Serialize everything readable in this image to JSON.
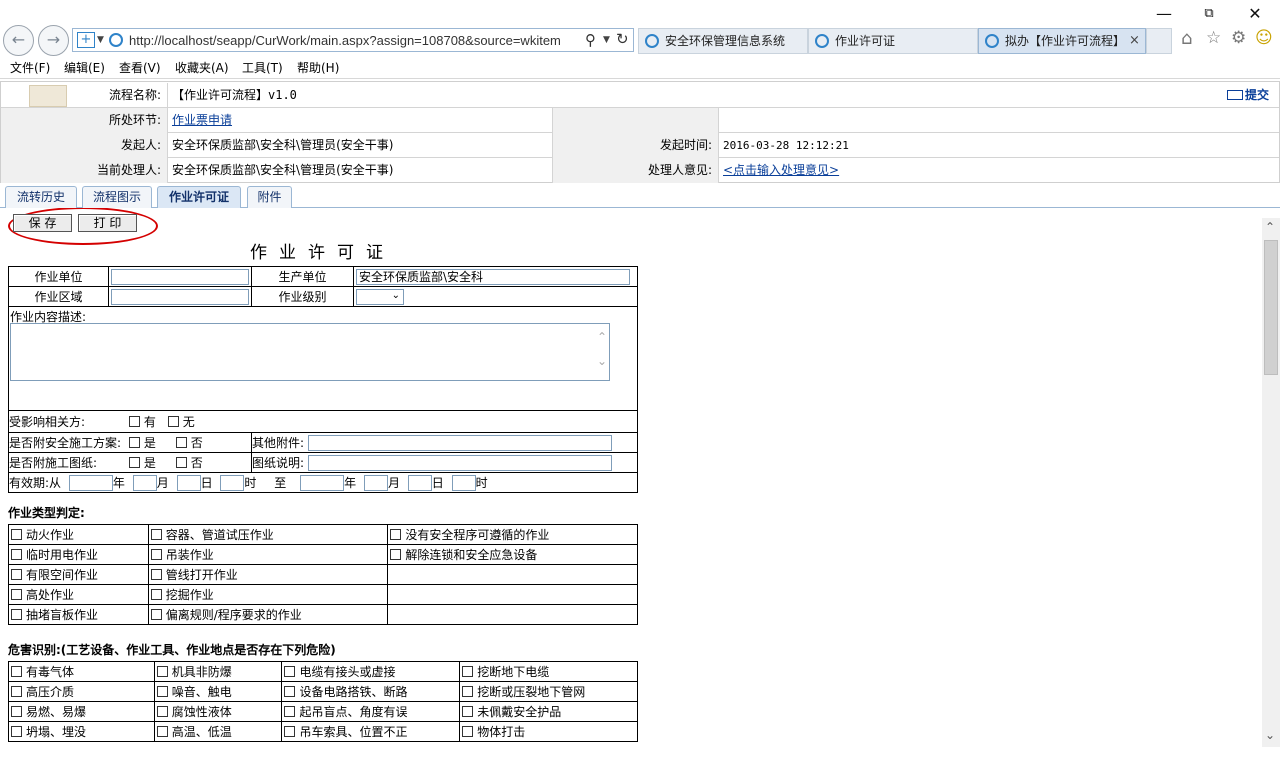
{
  "browser": {
    "url": "http://localhost/seapp/CurWork/main.aspx?assign=108708&source=wkitem",
    "tabs": [
      {
        "label": "安全环保管理信息系统",
        "active": false
      },
      {
        "label": "作业许可证",
        "active": false
      },
      {
        "label": "拟办【作业许可流程】",
        "active": true
      }
    ],
    "menu": [
      "文件(F)",
      "编辑(E)",
      "查看(V)",
      "收藏夹(A)",
      "工具(T)",
      "帮助(H)"
    ]
  },
  "header": {
    "flow_name_label": "流程名称:",
    "flow_name": "【作业许可流程】v1.0",
    "submit_label": "提交",
    "step_label": "所处环节:",
    "step_value": "作业票申请",
    "initiator_label": "发起人:",
    "initiator": "安全环保质监部\\安全科\\管理员(安全干事)",
    "start_time_label": "发起时间:",
    "start_time": "2016-03-28 12:12:21",
    "handler_label": "当前处理人:",
    "handler": "安全环保质监部\\安全科\\管理员(安全干事)",
    "opinion_label": "处理人意见:",
    "opinion_link": "<点击输入处理意见>"
  },
  "form_tabs": [
    {
      "label": "流转历史",
      "active": false
    },
    {
      "label": "流程图示",
      "active": false
    },
    {
      "label": "作业许可证",
      "active": true
    },
    {
      "label": "附件",
      "active": false
    }
  ],
  "actions": {
    "save": "保 存",
    "print": "打 印"
  },
  "form": {
    "title": "作业许可证",
    "work_unit_label": "作业单位",
    "work_unit_value": "",
    "prod_unit_label": "生产单位",
    "prod_unit_value": "安全环保质监部\\安全科",
    "work_area_label": "作业区域",
    "work_area_value": "",
    "work_level_label": "作业级别",
    "work_level_value": "",
    "desc_label": "作业内容描述:",
    "affected_label": "受影响相关方:",
    "opt_yes": "有",
    "opt_no": "无",
    "plan_label": "是否附安全施工方案:",
    "drawing_label": "是否附施工图纸:",
    "yes": "是",
    "no": "否",
    "other_attach_label": "其他附件:",
    "drawing_desc_label": "图纸说明:",
    "validity_label": "有效期:从",
    "year": "年",
    "month": "月",
    "day": "日",
    "hour": "时",
    "to": "至"
  },
  "work_types": {
    "title": "作业类型判定:",
    "rows": [
      [
        "动火作业",
        "容器、管道试压作业",
        "没有安全程序可遵循的作业"
      ],
      [
        "临时用电作业",
        "吊装作业",
        "解除连锁和安全应急设备"
      ],
      [
        "有限空间作业",
        "管线打开作业",
        ""
      ],
      [
        "高处作业",
        "挖掘作业",
        ""
      ],
      [
        "抽堵盲板作业",
        "偏离规则/程序要求的作业",
        ""
      ]
    ]
  },
  "hazards": {
    "title": "危害识别:(工艺设备、作业工具、作业地点是否存在下列危险)",
    "rows": [
      [
        "有毒气体",
        "机具非防爆",
        "电缆有接头或虚接",
        "挖断地下电缆"
      ],
      [
        "高压介质",
        "噪音、触电",
        "设备电路搭铁、断路",
        "挖断或压裂地下管网"
      ],
      [
        "易燃、易爆",
        "腐蚀性液体",
        "起吊盲点、角度有误",
        "未佩戴安全护品"
      ],
      [
        "坍塌、埋没",
        "高温、低温",
        "吊车索具、位置不正",
        "物体打击"
      ]
    ]
  }
}
